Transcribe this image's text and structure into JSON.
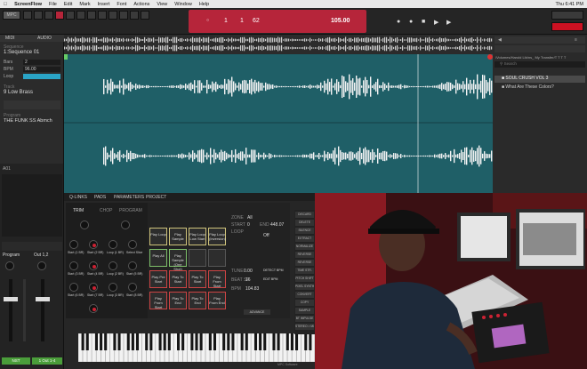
{
  "menubar": {
    "app": "ScreenFlow",
    "items": [
      "File",
      "Edit",
      "Mark",
      "Insert",
      "Font",
      "Actions",
      "View",
      "Window",
      "Help"
    ],
    "clock": "Thu 6:41 PM"
  },
  "transport": {
    "bar": "1",
    "beat": "1",
    "tick": "62",
    "tempo": "105.00",
    "left_buttons": [
      "MPC",
      "",
      "",
      "",
      "",
      ""
    ]
  },
  "left_panel": {
    "tabs": [
      "MIDI",
      "AUDIO"
    ],
    "sequence_label": "Sequence",
    "sequence_value": "1:Sequence 01",
    "fields": [
      {
        "label": "Bars",
        "value": "2"
      },
      {
        "label": "BPM",
        "value": "96.00"
      },
      {
        "label": "Loop",
        "value": ""
      }
    ],
    "track_label": "Track",
    "track_value": "9 Low Brass",
    "program_label": "Program",
    "program_value": "THE FUNK SS Abmch"
  },
  "browser": {
    "path": "/Volumes/Harold Lib/ns_ My Transfer/T T T T",
    "search_placeholder": "Search",
    "items": [
      "SOUL CRUSH VOL 3",
      "What Are These Colors?"
    ]
  },
  "mixer": {
    "output_label": "A01",
    "program_label": "Program",
    "out_label": "Out 1,2",
    "bottom_buttons": [
      "NST",
      "1 Out 1-4"
    ]
  },
  "editor": {
    "tabs": [
      "Q-LINKS",
      "PADS",
      "PARAMETERS",
      "PROJECT"
    ],
    "subtabs": [
      "TRIM",
      "CHOP",
      "PROGRAM"
    ],
    "knob_labels": [
      "Start (1 BR)",
      "Start (2 BR)",
      "Loop (1 BR)",
      "Select Slice",
      "Start (3 BR)",
      "Start (4 BR)",
      "Loop (2 BR)",
      "Start (5 BR)",
      "Start (6 BR)",
      "Start (7 BR)",
      "Loop (3 BR)",
      "Start (8 BR)"
    ],
    "pads_row1": [
      "Play Loop",
      "Play Sample",
      "Play Loop Low Start",
      "Play Loop (Inversion)"
    ],
    "pads_row2": [
      "Play All",
      "Play Sample (One Shot)",
      "",
      ""
    ],
    "pads_row3": [
      "Play Pre Start",
      "Play To Start",
      "Play To Start",
      "Play From Start"
    ],
    "pads_row4": [
      "Play From Start",
      "Play To End",
      "Play To End",
      "Play From End"
    ],
    "info_fields": [
      {
        "label": "ZONE",
        "value": "All"
      },
      {
        "label": "START",
        "value": "0"
      },
      {
        "label": "END",
        "value": "448.07"
      },
      {
        "label": "LOOP",
        "value": "Off"
      }
    ],
    "tune_label": "TUNE",
    "tune_value": "0.00",
    "detect_bpm": "DETECT BPM",
    "edit_bpm": "EDIT BPM",
    "bpm_value": "104.83",
    "bpm_label": "BPM",
    "beat_label": "BEAT SF",
    "beat_value": "16",
    "section_title": "FUNCTIONS",
    "function_buttons": [
      "DISCARD",
      "DELETE",
      "SILENCE",
      "EXTRACT",
      "NORMALIZE",
      "REVERSE",
      "REVERSE",
      "TIME STR.",
      "PITCH SHIFT",
      "PIXEL SYNTH",
      "CONVERT",
      "COPY",
      "SAMPLE",
      "BT IMPULSE",
      "STEREO > MONO"
    ],
    "bottom_label": "ADVANCE",
    "keyboard_label": "MPC Software"
  },
  "colors": {
    "accent_red": "#b6253a",
    "wave_bg": "#1f5f67",
    "wave_color": "#f4f4f4",
    "pad_yellow": "#cfc37a",
    "pad_green": "#7ec06a"
  }
}
